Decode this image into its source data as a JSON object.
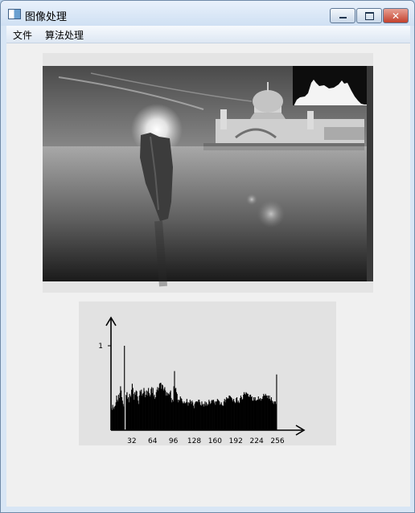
{
  "window": {
    "title": "图像处理"
  },
  "menu": {
    "file": "文件",
    "algorithm": "算法处理"
  },
  "image": {
    "kind": "grayscale-photo",
    "subject": "mosque on water with wooden post at sunrise"
  },
  "chart_data": {
    "type": "bar",
    "ytick_label": "1",
    "xtick_labels": [
      "32",
      "64",
      "96",
      "128",
      "160",
      "192",
      "224",
      "256"
    ],
    "xlim": [
      0,
      256
    ],
    "ylim": [
      0,
      1
    ],
    "values": [
      0.26,
      0.24,
      0.3,
      0.27,
      0.25,
      0.28,
      0.29,
      0.33,
      0.41,
      0.36,
      0.34,
      0.42,
      0.38,
      0.44,
      0.52,
      0.47,
      0.39,
      0.35,
      0.31,
      0.28,
      1.0,
      0.45,
      0.42,
      0.41,
      0.45,
      0.37,
      0.39,
      0.33,
      0.43,
      0.41,
      0.39,
      0.48,
      0.55,
      0.5,
      0.43,
      0.36,
      0.45,
      0.42,
      0.47,
      0.46,
      0.4,
      0.35,
      0.31,
      0.41,
      0.47,
      0.45,
      0.48,
      0.41,
      0.43,
      0.44,
      0.5,
      0.46,
      0.39,
      0.42,
      0.47,
      0.41,
      0.46,
      0.5,
      0.44,
      0.4,
      0.42,
      0.49,
      0.51,
      0.44,
      0.5,
      0.4,
      0.42,
      0.37,
      0.39,
      0.45,
      0.48,
      0.51,
      0.47,
      0.5,
      0.55,
      0.56,
      0.56,
      0.49,
      0.54,
      0.53,
      0.47,
      0.49,
      0.51,
      0.47,
      0.41,
      0.45,
      0.41,
      0.44,
      0.43,
      0.42,
      0.45,
      0.47,
      0.38,
      0.33,
      0.36,
      0.34,
      0.52,
      0.7,
      0.49,
      0.5,
      0.45,
      0.43,
      0.36,
      0.33,
      0.36,
      0.35,
      0.4,
      0.38,
      0.37,
      0.34,
      0.32,
      0.32,
      0.34,
      0.32,
      0.32,
      0.33,
      0.37,
      0.33,
      0.29,
      0.33,
      0.32,
      0.36,
      0.34,
      0.31,
      0.35,
      0.33,
      0.29,
      0.26,
      0.31,
      0.33,
      0.34,
      0.34,
      0.34,
      0.33,
      0.36,
      0.36,
      0.33,
      0.3,
      0.29,
      0.34,
      0.3,
      0.31,
      0.28,
      0.31,
      0.34,
      0.29,
      0.33,
      0.29,
      0.31,
      0.3,
      0.36,
      0.34,
      0.31,
      0.32,
      0.35,
      0.36,
      0.35,
      0.36,
      0.32,
      0.34,
      0.3,
      0.34,
      0.34,
      0.37,
      0.36,
      0.35,
      0.34,
      0.3,
      0.31,
      0.33,
      0.3,
      0.29,
      0.29,
      0.34,
      0.37,
      0.33,
      0.36,
      0.39,
      0.37,
      0.38,
      0.37,
      0.41,
      0.41,
      0.4,
      0.39,
      0.38,
      0.36,
      0.34,
      0.37,
      0.34,
      0.32,
      0.33,
      0.38,
      0.39,
      0.33,
      0.35,
      0.33,
      0.32,
      0.38,
      0.41,
      0.39,
      0.36,
      0.37,
      0.42,
      0.45,
      0.43,
      0.42,
      0.45,
      0.44,
      0.43,
      0.43,
      0.4,
      0.39,
      0.42,
      0.42,
      0.39,
      0.4,
      0.35,
      0.35,
      0.39,
      0.36,
      0.39,
      0.35,
      0.35,
      0.36,
      0.36,
      0.4,
      0.36,
      0.37,
      0.38,
      0.35,
      0.37,
      0.37,
      0.4,
      0.43,
      0.41,
      0.41,
      0.43,
      0.41,
      0.41,
      0.38,
      0.41,
      0.37,
      0.41,
      0.37,
      0.35,
      0.39,
      0.35,
      0.32,
      0.34,
      0.31,
      0.34,
      0.34,
      0.31,
      0.66
    ]
  }
}
